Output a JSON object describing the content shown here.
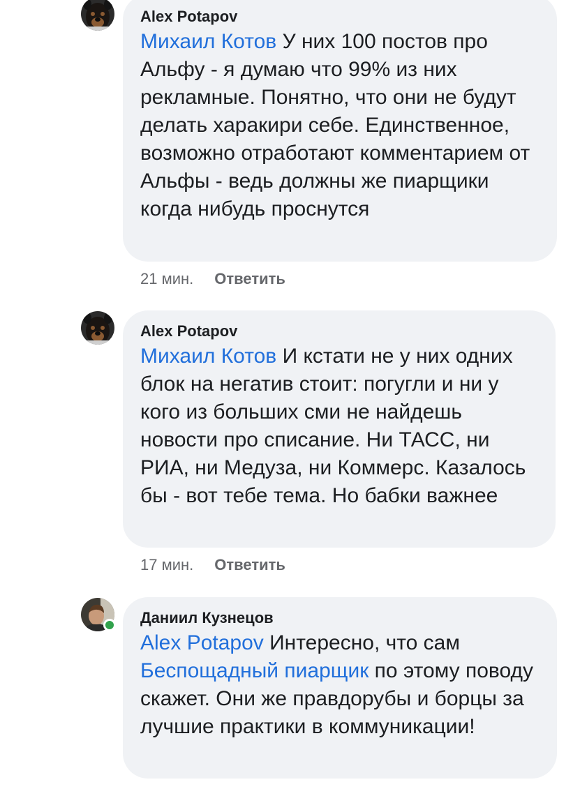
{
  "comments": [
    {
      "author": "Alex Potapov",
      "mention": "Михаил Котов",
      "text": " У них 100 постов про Альфу - я думаю что 99% из них рекламные. Понятно, что они не будут делать харакири себе. Единственное, возможно отработают комментарием от Альфы - ведь должны же пиарщики когда нибудь проснутся",
      "time": "21 мин.",
      "reply_label": "Ответить"
    },
    {
      "author": "Alex Potapov",
      "mention": "Михаил Котов",
      "text": " И кстати не у них одних блок на негатив стоит: погугли и ни у кого из больших сми не найдешь новости про списание. Ни ТАСС, ни РИА, ни Медуза, ни Коммерс. Казалось бы - вот тебе тема. Но бабки важнее",
      "time": "17 мин.",
      "reply_label": "Ответить"
    },
    {
      "author": "Даниил Кузнецов",
      "mention": "Alex Potapov",
      "text_a": " Интересно, что сам ",
      "mention2": "Беспощадный пиарщик",
      "text_b": " по этому поводу скажет. Они же правдорубы и борцы за лучшие практики в коммуникации!"
    }
  ],
  "colors": {
    "mention": "#216fdb",
    "bubble": "#f0f2f5",
    "meta": "#65676b",
    "online": "#31a24c"
  },
  "icons": [
    "rottweiler-avatar",
    "user-photo-avatar",
    "online-status-dot"
  ]
}
